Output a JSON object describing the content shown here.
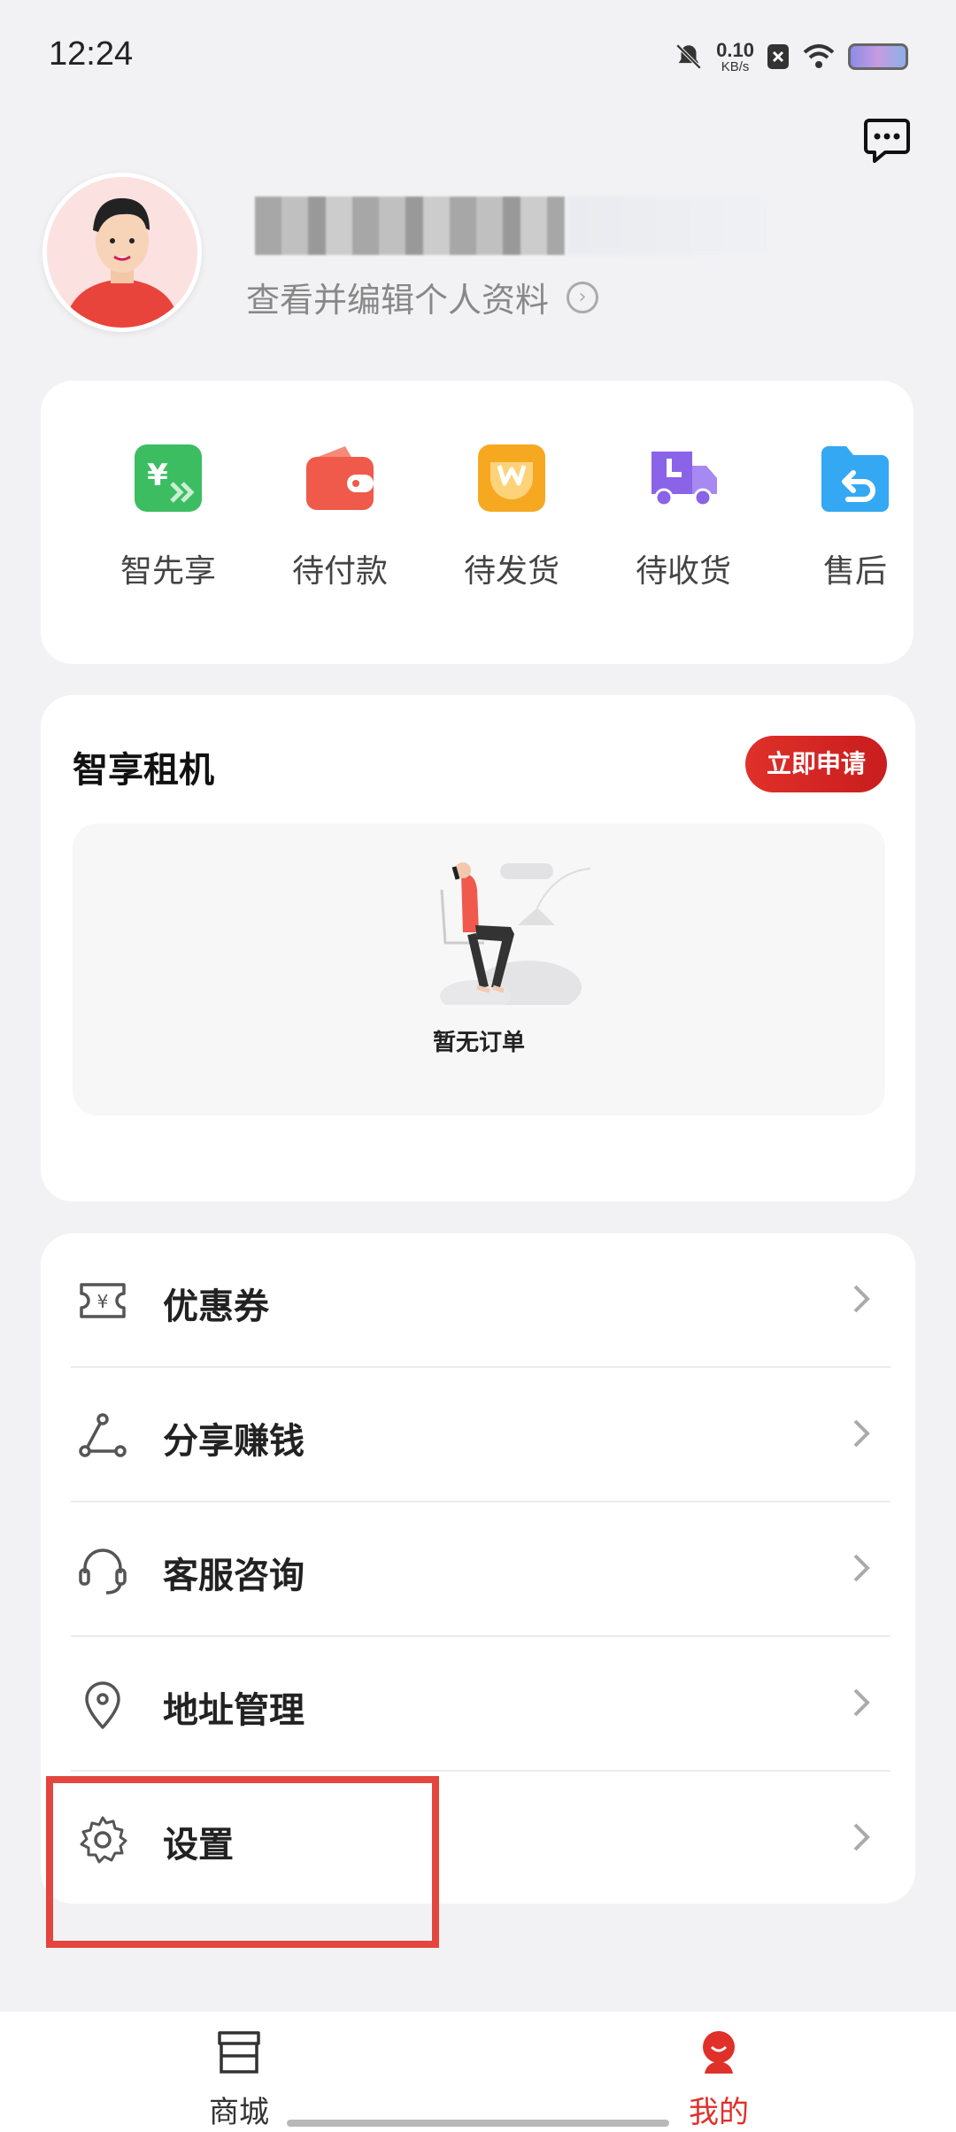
{
  "status_bar": {
    "time": "12:24",
    "net_speed_value": "0.10",
    "net_speed_unit": "KB/s"
  },
  "profile": {
    "subtitle": "查看并编辑个人资料"
  },
  "orders": {
    "items": [
      {
        "label": "智先享",
        "icon": "yen-transfer-icon",
        "color": "#3dbd62"
      },
      {
        "label": "待付款",
        "icon": "wallet-icon",
        "color": "#f05a4a"
      },
      {
        "label": "待发货",
        "icon": "package-icon",
        "color": "#f7a821"
      },
      {
        "label": "待收货",
        "icon": "truck-icon",
        "color": "#8a63e8"
      },
      {
        "label": "售后",
        "icon": "return-folder-icon",
        "color": "#34a8f2"
      }
    ]
  },
  "rent": {
    "title": "智享租机",
    "apply_label": "立即申请",
    "empty_text": "暂无订单"
  },
  "menu": {
    "items": [
      {
        "label": "优惠券",
        "icon": "coupon-icon"
      },
      {
        "label": "分享赚钱",
        "icon": "share-icon"
      },
      {
        "label": "客服咨询",
        "icon": "headset-icon"
      },
      {
        "label": "地址管理",
        "icon": "location-pin-icon"
      },
      {
        "label": "设置",
        "icon": "gear-icon"
      }
    ]
  },
  "bottom_nav": {
    "items": [
      {
        "label": "商城",
        "icon": "store-icon",
        "active": false
      },
      {
        "label": "我的",
        "icon": "mine-icon",
        "active": true
      }
    ],
    "active_color": "#e0302a",
    "inactive_color": "#333333"
  }
}
